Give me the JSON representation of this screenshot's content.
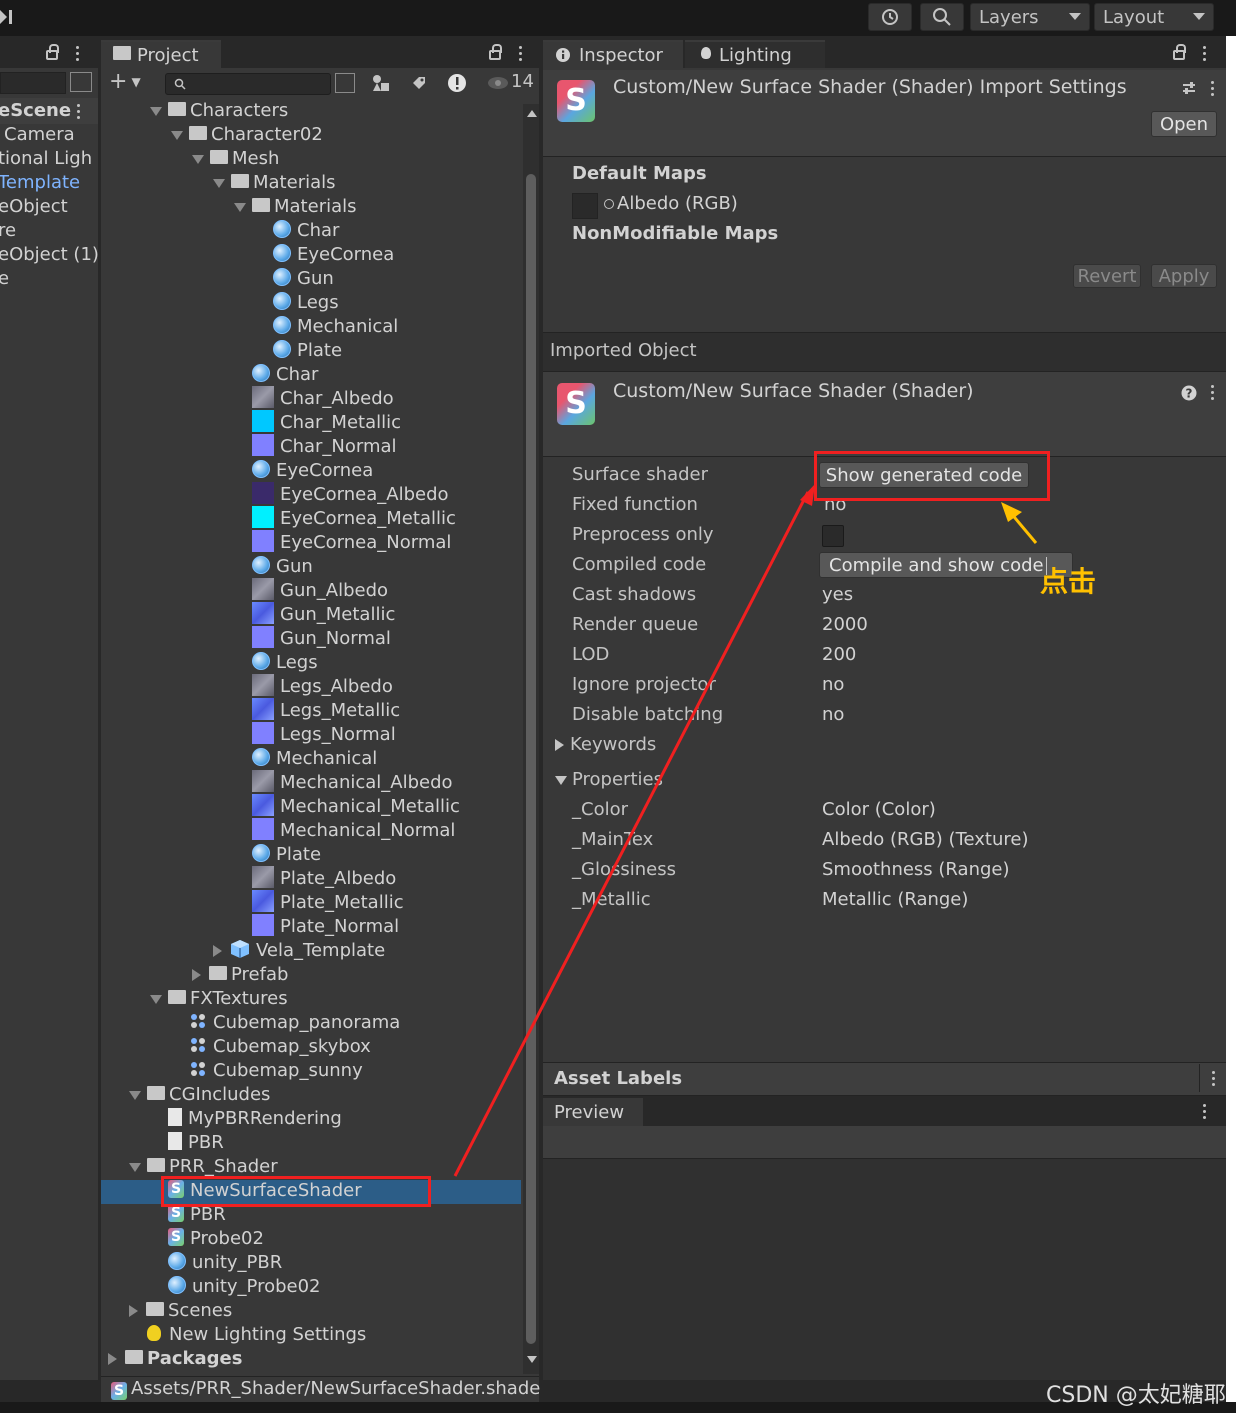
{
  "toolbar": {
    "layers_label": "Layers",
    "layout_label": "Layout"
  },
  "hierarchy": {
    "items": [
      "eScene",
      "Camera",
      "tional Ligh",
      "Template",
      "eObject",
      "re",
      "eObject (1)",
      "e"
    ]
  },
  "project": {
    "tab_label": "Project",
    "hidden_count": "14",
    "tree": [
      {
        "label": "Characters",
        "type": "folder-open"
      },
      {
        "label": "Character02",
        "type": "folder-open"
      },
      {
        "label": "Mesh",
        "type": "folder-open"
      },
      {
        "label": "Materials",
        "type": "folder-open"
      },
      {
        "label": "Materials",
        "type": "folder-open"
      },
      {
        "label": "Char",
        "type": "material"
      },
      {
        "label": "EyeCornea",
        "type": "material"
      },
      {
        "label": "Gun",
        "type": "material"
      },
      {
        "label": "Legs",
        "type": "material"
      },
      {
        "label": "Mechanical",
        "type": "material"
      },
      {
        "label": "Plate",
        "type": "material"
      },
      {
        "label": "Char",
        "type": "material"
      },
      {
        "label": "Char_Albedo",
        "type": "texture-albedo"
      },
      {
        "label": "Char_Metallic",
        "type": "texture-metallic"
      },
      {
        "label": "Char_Normal",
        "type": "texture-normal"
      },
      {
        "label": "EyeCornea",
        "type": "material"
      },
      {
        "label": "EyeCornea_Albedo",
        "type": "texture-dark"
      },
      {
        "label": "EyeCornea_Metallic",
        "type": "texture-cyan"
      },
      {
        "label": "EyeCornea_Normal",
        "type": "texture-normal"
      },
      {
        "label": "Gun",
        "type": "material"
      },
      {
        "label": "Gun_Albedo",
        "type": "texture-albedo"
      },
      {
        "label": "Gun_Metallic",
        "type": "texture-metallic-blue"
      },
      {
        "label": "Gun_Normal",
        "type": "texture-normal"
      },
      {
        "label": "Legs",
        "type": "material"
      },
      {
        "label": "Legs_Albedo",
        "type": "texture-albedo"
      },
      {
        "label": "Legs_Metallic",
        "type": "texture-metallic-blue"
      },
      {
        "label": "Legs_Normal",
        "type": "texture-normal"
      },
      {
        "label": "Mechanical",
        "type": "material"
      },
      {
        "label": "Mechanical_Albedo",
        "type": "texture-albedo"
      },
      {
        "label": "Mechanical_Metallic",
        "type": "texture-metallic-blue"
      },
      {
        "label": "Mechanical_Normal",
        "type": "texture-normal"
      },
      {
        "label": "Plate",
        "type": "material"
      },
      {
        "label": "Plate_Albedo",
        "type": "texture-albedo"
      },
      {
        "label": "Plate_Metallic",
        "type": "texture-metallic-blue"
      },
      {
        "label": "Plate_Normal",
        "type": "texture-normal"
      },
      {
        "label": "Vela_Template",
        "type": "prefab"
      },
      {
        "label": "Prefab",
        "type": "folder"
      },
      {
        "label": "FXTextures",
        "type": "folder-open"
      },
      {
        "label": "Cubemap_panorama",
        "type": "cubemap"
      },
      {
        "label": "Cubemap_skybox",
        "type": "cubemap"
      },
      {
        "label": "Cubemap_sunny",
        "type": "cubemap"
      },
      {
        "label": "CGIncludes",
        "type": "folder-open"
      },
      {
        "label": "MyPBRRendering",
        "type": "doc"
      },
      {
        "label": "PBR",
        "type": "doc"
      },
      {
        "label": "PRR_Shader",
        "type": "folder-open"
      },
      {
        "label": "NewSurfaceShader",
        "type": "shader"
      },
      {
        "label": "PBR",
        "type": "shader"
      },
      {
        "label": "Probe02",
        "type": "shader"
      },
      {
        "label": "unity_PBR",
        "type": "material"
      },
      {
        "label": "unity_Probe02",
        "type": "material"
      },
      {
        "label": "Scenes",
        "type": "folder"
      },
      {
        "label": "New Lighting Settings",
        "type": "lighting"
      },
      {
        "label": "Packages",
        "type": "folder"
      }
    ],
    "footer_path": "Assets/PRR_Shader/NewSurfaceShader.shade"
  },
  "inspector": {
    "tab_inspector": "Inspector",
    "tab_lighting": "Lighting",
    "import_title": "Custom/New Surface Shader (Shader) Import Settings",
    "open_label": "Open",
    "default_maps": "Default Maps",
    "albedo_label": "Albedo (RGB)",
    "nonmodifiable_maps": "NonModifiable Maps",
    "revert_label": "Revert",
    "apply_label": "Apply",
    "imported_object": "Imported Object",
    "shader_title": "Custom/New Surface Shader (Shader)",
    "surface_shader_label": "Surface shader",
    "show_generated_code": "Show generated code",
    "fixed_function_label": "Fixed function",
    "fixed_function_value": "no",
    "preprocess_only_label": "Preprocess only",
    "compiled_code_label": "Compiled code",
    "compile_and_show": "Compile and show code",
    "cast_shadows_label": "Cast shadows",
    "cast_shadows_value": "yes",
    "render_queue_label": "Render queue",
    "render_queue_value": "2000",
    "lod_label": "LOD",
    "lod_value": "200",
    "ignore_projector_label": "Ignore projector",
    "ignore_projector_value": "no",
    "disable_batching_label": "Disable batching",
    "disable_batching_value": "no",
    "keywords_label": "Keywords",
    "properties_label": "Properties",
    "properties": [
      {
        "name": "_Color",
        "value": "Color (Color)"
      },
      {
        "name": "_MainTex",
        "value": "Albedo (RGB) (Texture)"
      },
      {
        "name": "_Glossiness",
        "value": "Smoothness (Range)"
      },
      {
        "name": "_Metallic",
        "value": "Metallic (Range)"
      }
    ],
    "asset_labels": "Asset Labels",
    "preview_label": "Preview"
  },
  "annotation": {
    "click_text": "点击",
    "watermark": "CSDN @太妃糖耶"
  },
  "colors": {
    "highlight_row": "#2c5d87",
    "annotation_red": "#f02020",
    "annotation_yellow": "#ffc000",
    "link_blue": "#7fb4ff"
  }
}
